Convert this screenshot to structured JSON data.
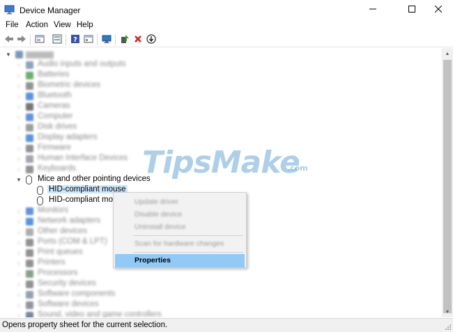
{
  "window": {
    "title": "Device Manager",
    "controls": {
      "minimize": "minimize-icon",
      "maximize": "maximize-icon",
      "close": "close-icon"
    }
  },
  "menu": [
    "File",
    "Action",
    "View",
    "Help"
  ],
  "toolbar": {
    "buttons": [
      "back-arrow-icon",
      "forward-arrow-icon",
      "properties-panel-icon",
      "show-hidden-icon",
      "help-icon",
      "update-driver-icon",
      "monitor-icon",
      "enable-device-icon",
      "uninstall-icon",
      "download-icon"
    ]
  },
  "tree": {
    "root": "                          ",
    "categories_blurred": [
      "Audio inputs and outputs",
      "Batteries",
      "Biometric devices",
      "Bluetooth",
      "Cameras",
      "Computer",
      "Disk drives",
      "Display adapters",
      "Firmware",
      "Human Interface Devices",
      "Keyboards"
    ],
    "expanded_category": "Mice and other pointing devices",
    "children": [
      "HID-compliant mouse",
      "HID-compliant mouse"
    ],
    "categories_after_blurred": [
      "Monitors",
      "Network adapters",
      "Other devices",
      "Ports (COM & LPT)",
      "Print queues",
      "Printers",
      "Processors",
      "Security devices",
      "Software components",
      "Software devices",
      "Sound, video and game controllers"
    ]
  },
  "context_menu": {
    "disabled_items": [
      "Update driver",
      "Disable device",
      "Uninstall device"
    ],
    "scan_item": "Scan for hardware changes",
    "highlighted_item": "Properties"
  },
  "watermark": {
    "main": "TipsMake",
    "domain": ".com"
  },
  "status": {
    "text": "Opens property sheet for the current selection."
  },
  "colors": {
    "selection": "#cce8ff",
    "menu_highlight": "#91c9f7",
    "accent": "#3c78d8"
  }
}
